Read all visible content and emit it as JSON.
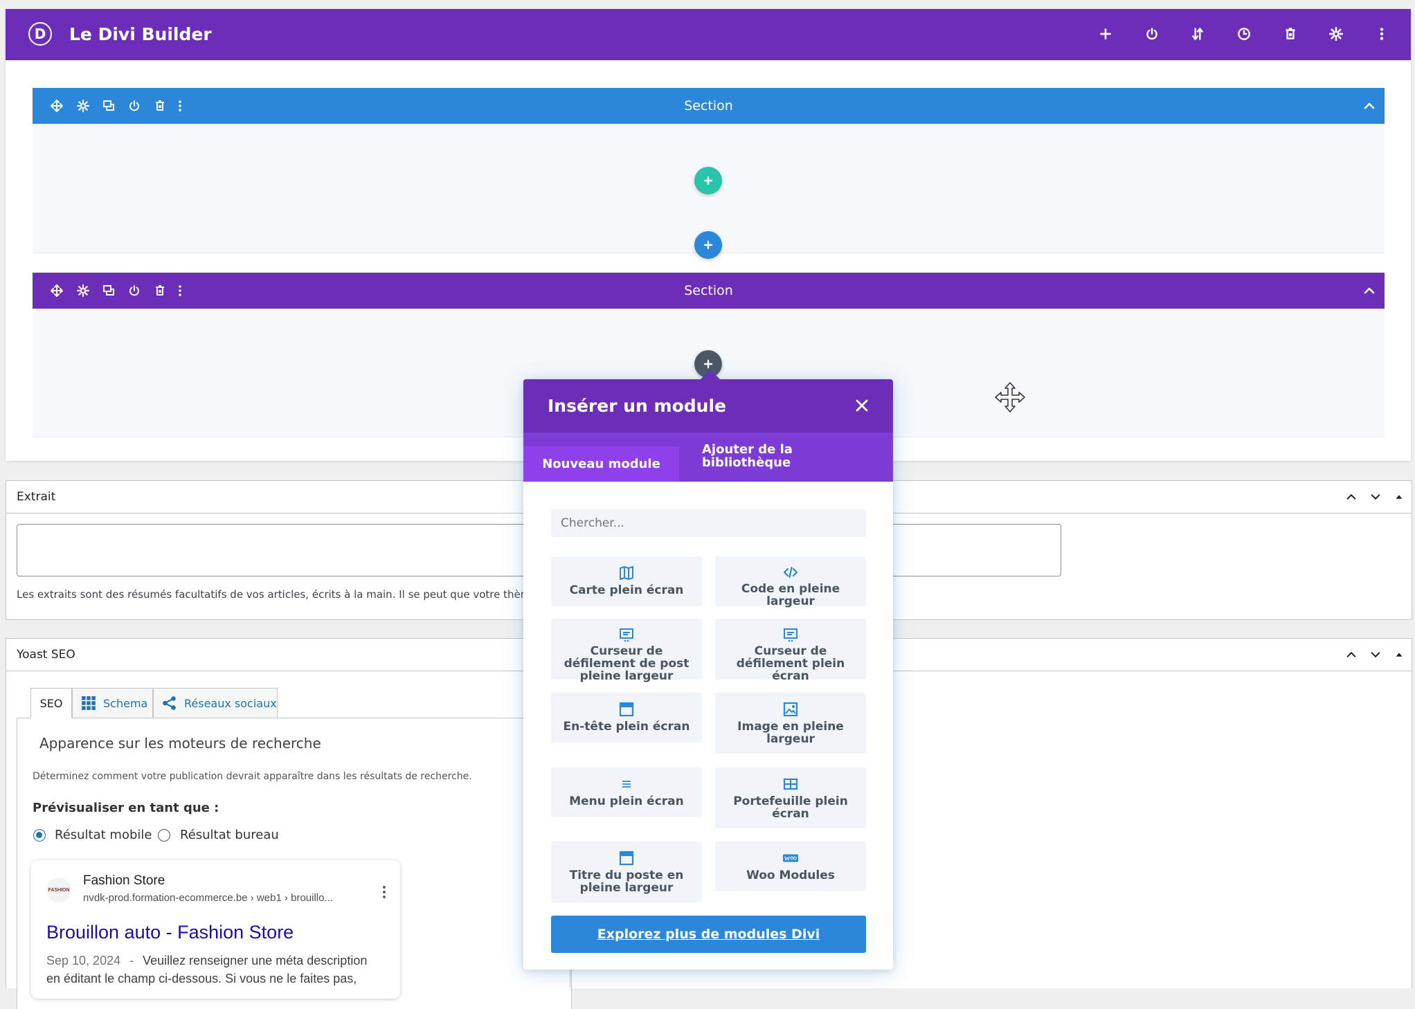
{
  "builder": {
    "title": "Le Divi Builder",
    "logo_letter": "D",
    "toolbar_icons": [
      "plus-icon",
      "power-icon",
      "sort-icon",
      "history-icon",
      "trash-icon",
      "gear-icon",
      "more-vertical-icon"
    ],
    "colors": {
      "primary": "#6c2eb9",
      "section_blue": "#2b87da",
      "row_green": "#29c4a9",
      "modal_tab": "#7d3cd6"
    }
  },
  "sections": [
    {
      "label": "Section",
      "color": "#2b87da"
    },
    {
      "label": "Section",
      "color": "#6c2eb9"
    }
  ],
  "excerpt": {
    "title": "Extrait",
    "value": "",
    "help": "Les extraits sont des résumés facultatifs de vos articles, écrits à la main. Il se peut que votre thèm"
  },
  "yoast": {
    "title": "Yoast SEO",
    "tabs": [
      {
        "label": "SEO",
        "icon": ""
      },
      {
        "label": "Schema",
        "icon": "grid-icon"
      },
      {
        "label": "Réseaux sociaux",
        "icon": "share-icon"
      }
    ],
    "heading": "Apparence sur les moteurs de recherche",
    "description": "Déterminez comment votre publication devrait apparaître dans les résultats de recherche.",
    "preview_label": "Prévisualiser en tant que :",
    "radio_mobile": "Résultat mobile",
    "radio_desktop": "Résultat bureau",
    "radio_selected": "mobile",
    "preview": {
      "site_name": "Fashion Store",
      "favicon_text": "FASHION",
      "url": "nvdk-prod.formation-ecommerce.be › web1 › brouillo...",
      "title": "Brouillon auto - Fashion Store",
      "date": "Sep 10, 2024",
      "separator": "-",
      "snippet_line1": "Veuillez renseigner une méta description",
      "snippet_line2": "en éditant le champ ci-dessous. Si vous ne le faites pas,"
    }
  },
  "modal": {
    "title": "Insérer un module",
    "tab_new": "Nouveau module",
    "tab_library": "Ajouter de la bibliothèque",
    "search_placeholder": "Chercher...",
    "modules": [
      {
        "label": "Carte plein écran",
        "icon": "map-icon"
      },
      {
        "label": "Code en pleine largeur",
        "icon": "code-icon"
      },
      {
        "label": "Curseur de défilement de post pleine largeur",
        "icon": "slider-icon"
      },
      {
        "label": "Curseur de défilement plein écran",
        "icon": "slider-icon"
      },
      {
        "label": "En-tête plein écran",
        "icon": "header-icon"
      },
      {
        "label": "Image en pleine largeur",
        "icon": "image-icon"
      },
      {
        "label": "Menu plein écran",
        "icon": "menu-icon"
      },
      {
        "label": "Portefeuille plein écran",
        "icon": "portfolio-icon"
      },
      {
        "label": "Titre du poste en pleine largeur",
        "icon": "title-icon"
      },
      {
        "label": "Woo Modules",
        "icon": "woo-icon"
      }
    ],
    "explore_label": "Explorez plus de modules Divi"
  }
}
